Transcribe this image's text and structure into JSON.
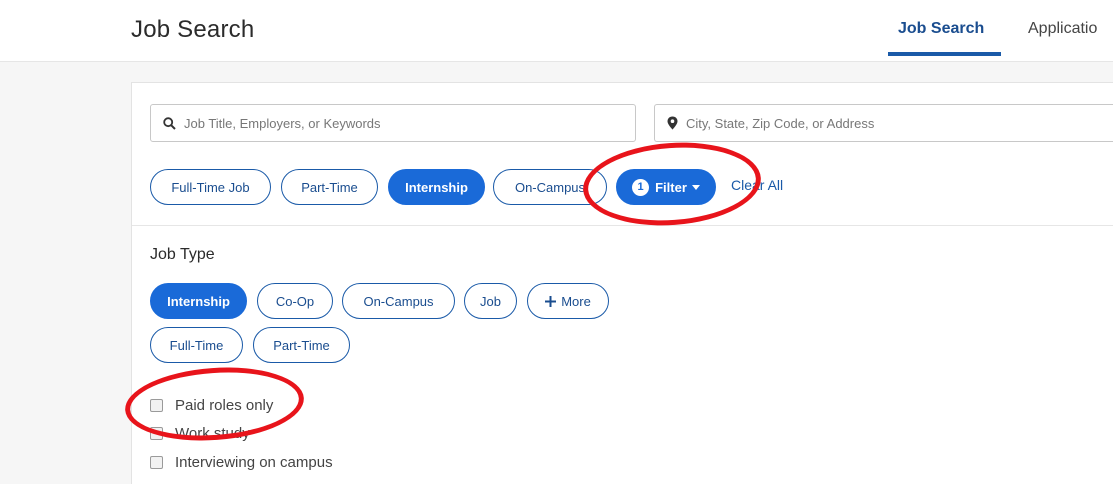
{
  "header": {
    "title": "Job Search",
    "tabs": [
      {
        "label": "Job Search",
        "active": true
      },
      {
        "label": "Applicatio",
        "active": false
      }
    ]
  },
  "search": {
    "keyword_placeholder": "Job Title, Employers, or Keywords",
    "location_placeholder": "City, State, Zip Code, or Address",
    "keyword_value": "",
    "location_value": ""
  },
  "quick_filters": [
    {
      "label": "Full-Time Job",
      "selected": false
    },
    {
      "label": "Part-Time",
      "selected": false
    },
    {
      "label": "Internship",
      "selected": true
    },
    {
      "label": "On-Campus",
      "selected": false
    }
  ],
  "filter_button": {
    "label": "Filter",
    "count": "1"
  },
  "clear_all": "Clear All",
  "job_type": {
    "title": "Job Type",
    "options": [
      {
        "label": "Internship",
        "selected": true
      },
      {
        "label": "Co-Op",
        "selected": false
      },
      {
        "label": "On-Campus",
        "selected": false
      },
      {
        "label": "Job",
        "selected": false
      },
      {
        "label": "More",
        "selected": false,
        "icon": "plus-icon"
      },
      {
        "label": "Full-Time",
        "selected": false
      },
      {
        "label": "Part-Time",
        "selected": false
      }
    ]
  },
  "checkboxes": [
    {
      "label": "Paid roles only",
      "checked": false
    },
    {
      "label": "Work study",
      "checked": false
    },
    {
      "label": "Interviewing on campus",
      "checked": false
    }
  ],
  "colors": {
    "accent": "#1a6ad8",
    "link": "#1a5aa8",
    "annotation": "#e8141b"
  }
}
